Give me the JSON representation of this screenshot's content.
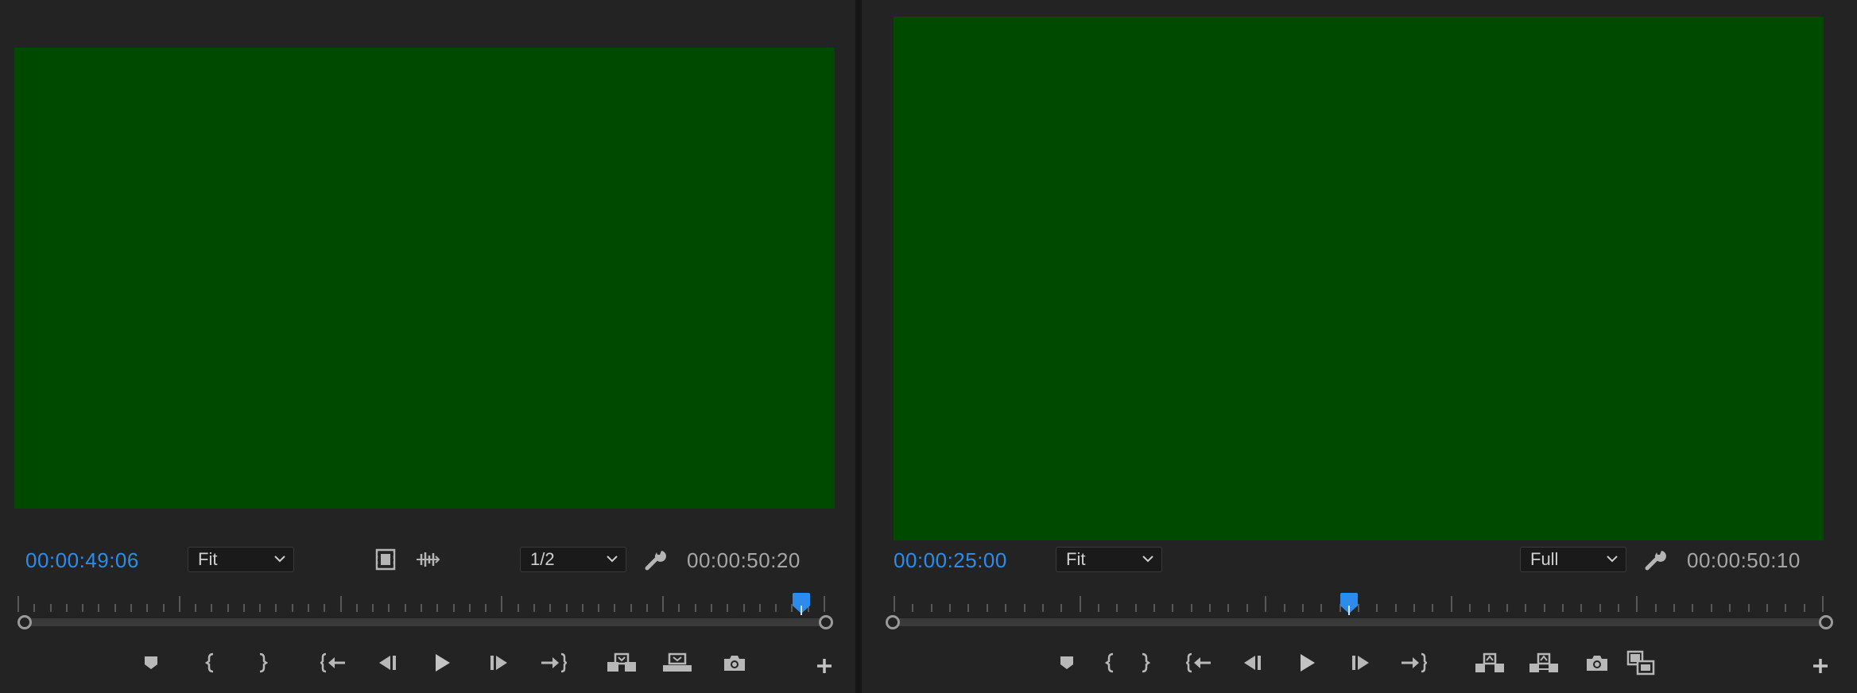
{
  "source_monitor": {
    "current_timecode": "00:00:49:06",
    "zoom": "Fit",
    "resolution": "1/2",
    "duration_timecode": "00:00:50:20",
    "playhead_fraction": 0.97,
    "frame_color": "#004a00",
    "controls": [
      "add-marker",
      "mark-in",
      "mark-out",
      "go-to-in",
      "step-back",
      "play",
      "step-forward",
      "go-to-out",
      "insert",
      "overwrite",
      "export-frame"
    ]
  },
  "program_monitor": {
    "current_timecode": "00:00:25:00",
    "zoom": "Fit",
    "resolution": "Full",
    "duration_timecode": "00:00:50:10",
    "playhead_fraction": 0.49,
    "frame_color": "#004a00",
    "controls": [
      "add-marker",
      "mark-in",
      "mark-out",
      "go-to-in",
      "step-back",
      "play",
      "step-forward",
      "go-to-out",
      "lift",
      "extract",
      "export-frame",
      "comparison-view"
    ]
  },
  "colors": {
    "accent": "#2d8ceb",
    "panel_bg": "#232323"
  }
}
